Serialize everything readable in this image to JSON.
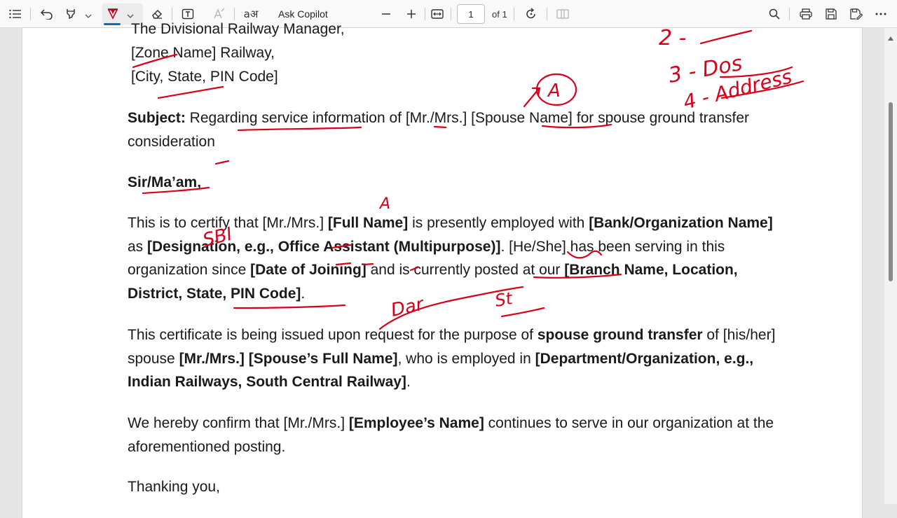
{
  "toolbar": {
    "ask_copilot": "Ask Copilot",
    "page_number": "1",
    "page_total": "of 1"
  },
  "document": {
    "address": [
      "The Divisional Railway Manager,",
      "[Zone Name] Railway,",
      "[City, State, PIN Code]"
    ],
    "subject_label": "Subject:",
    "subject_text": " Regarding service information of [Mr./Mrs.] [Spouse Name] for spouse ground transfer consideration",
    "salutation": "Sir/Ma’am,",
    "p1": {
      "t1": "This is to certify that [Mr./Mrs.] ",
      "b1": "[Full Name]",
      "t2": " is presently employed with ",
      "b2": "[Bank/Organization Name]",
      "t3": " as ",
      "b3": "[Designation, e.g., Office Assistant (Multipurpose)]",
      "t4": ". [He/She] has been serving in this organization since ",
      "b4": "[Date of Joining]",
      "t5": " and is currently posted at our ",
      "b5": "[Branch Name, Location, District, State, PIN Code]",
      "t6": "."
    },
    "p2": {
      "t1": "This certificate is being issued upon request for the purpose of ",
      "b1": "spouse ground transfer",
      "t2": " of [his/her] spouse ",
      "b2": "[Mr./Mrs.] [Spouse’s Full Name]",
      "t3": ", who is employed in ",
      "b3": "[Department/Organization, e.g., Indian Railways, South Central Railway]",
      "t4": "."
    },
    "p3": {
      "t1": "We hereby confirm that [Mr./Mrs.] ",
      "b1": "[Employee’s Name]",
      "t2": " continues to serve in our organization at the aforementioned posting."
    },
    "closing": "Thanking you,"
  },
  "ink_notes": {
    "n1": "2 -",
    "n2": "3 - Dos",
    "n3": "4 - Address",
    "n4": "A",
    "n5": "A",
    "n6": "SBI",
    "n7": "Dar",
    "n8": "St"
  },
  "colors": {
    "ink": "#d9001b",
    "accent": "#0f6cbd"
  }
}
